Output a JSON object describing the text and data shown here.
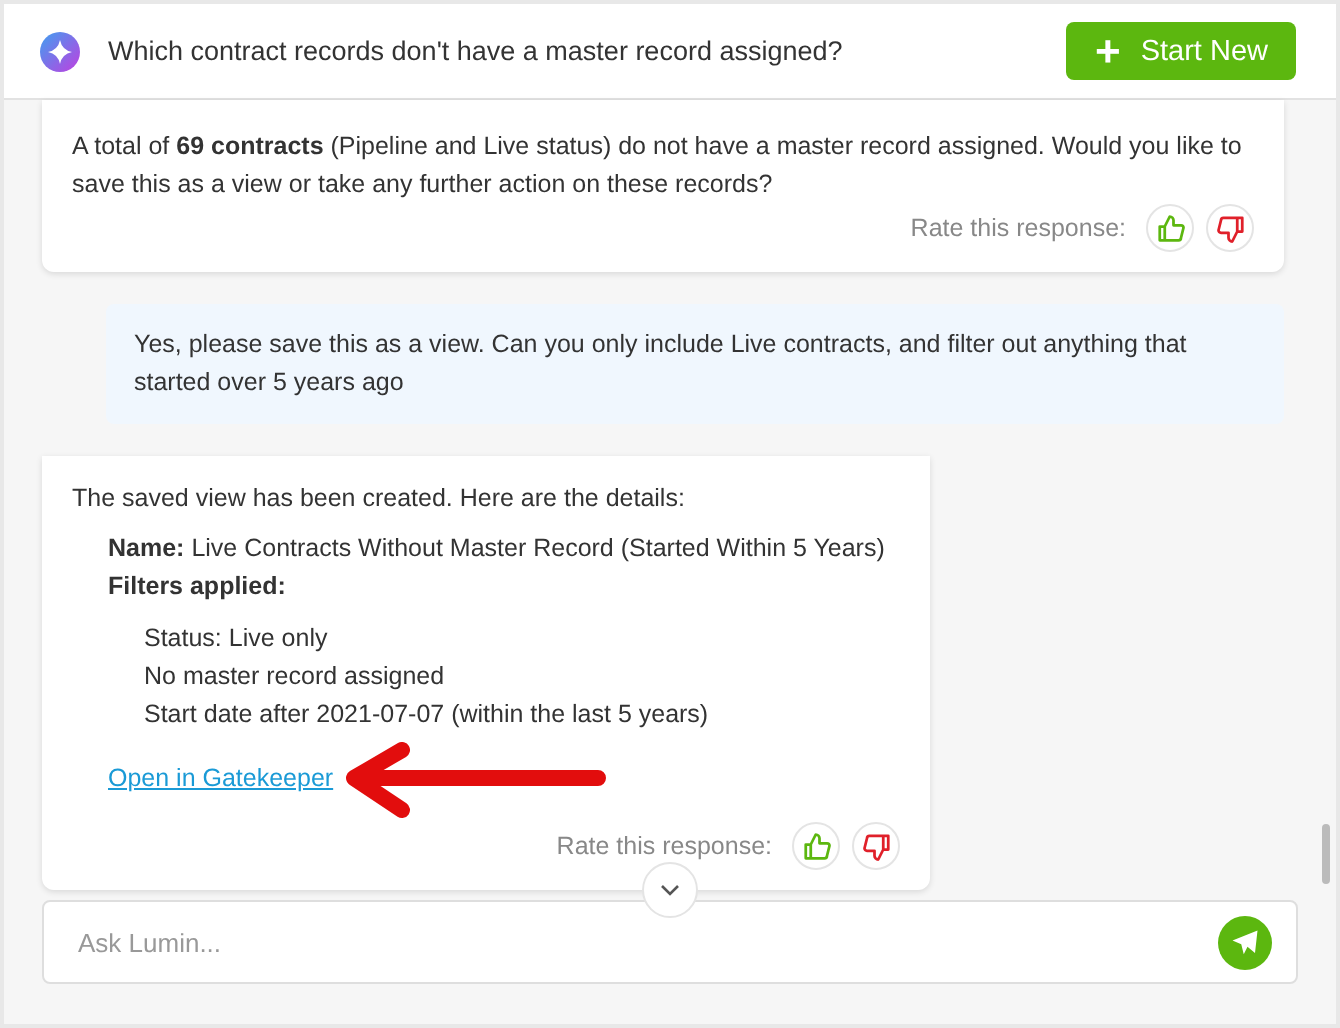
{
  "header": {
    "title": "Which contract records don't have a master record assigned?",
    "new_button": {
      "icon": "+",
      "label": "Start New"
    }
  },
  "messages": [
    {
      "kind": "assistant",
      "paragraph": "A total of **69 contracts** (Pipeline and Live status) do not have a master record assigned. Would you like to save this as a view or take any further action on these records?",
      "rating_label": "Rate this response:"
    },
    {
      "kind": "user",
      "paragraph": "Yes, please save this as a view. Can you only include Live contracts, and filter out anything that started over 5 years ago"
    },
    {
      "kind": "assistant",
      "paragraph": "The saved view has been created. Here are the details:",
      "details": [
        "**Name:** Live Contracts Without Master Record (Started Within 5 Years)",
        "**Filters applied:**"
      ],
      "filters": [
        "Status: Live only",
        "No master record assigned",
        "Start date after 2021-07-07 (within the last 5 years)"
      ],
      "link": "Open in Gatekeeper",
      "rating_label": "Rate this response:"
    }
  ],
  "composer": {
    "placeholder": "Ask Lumin..."
  }
}
